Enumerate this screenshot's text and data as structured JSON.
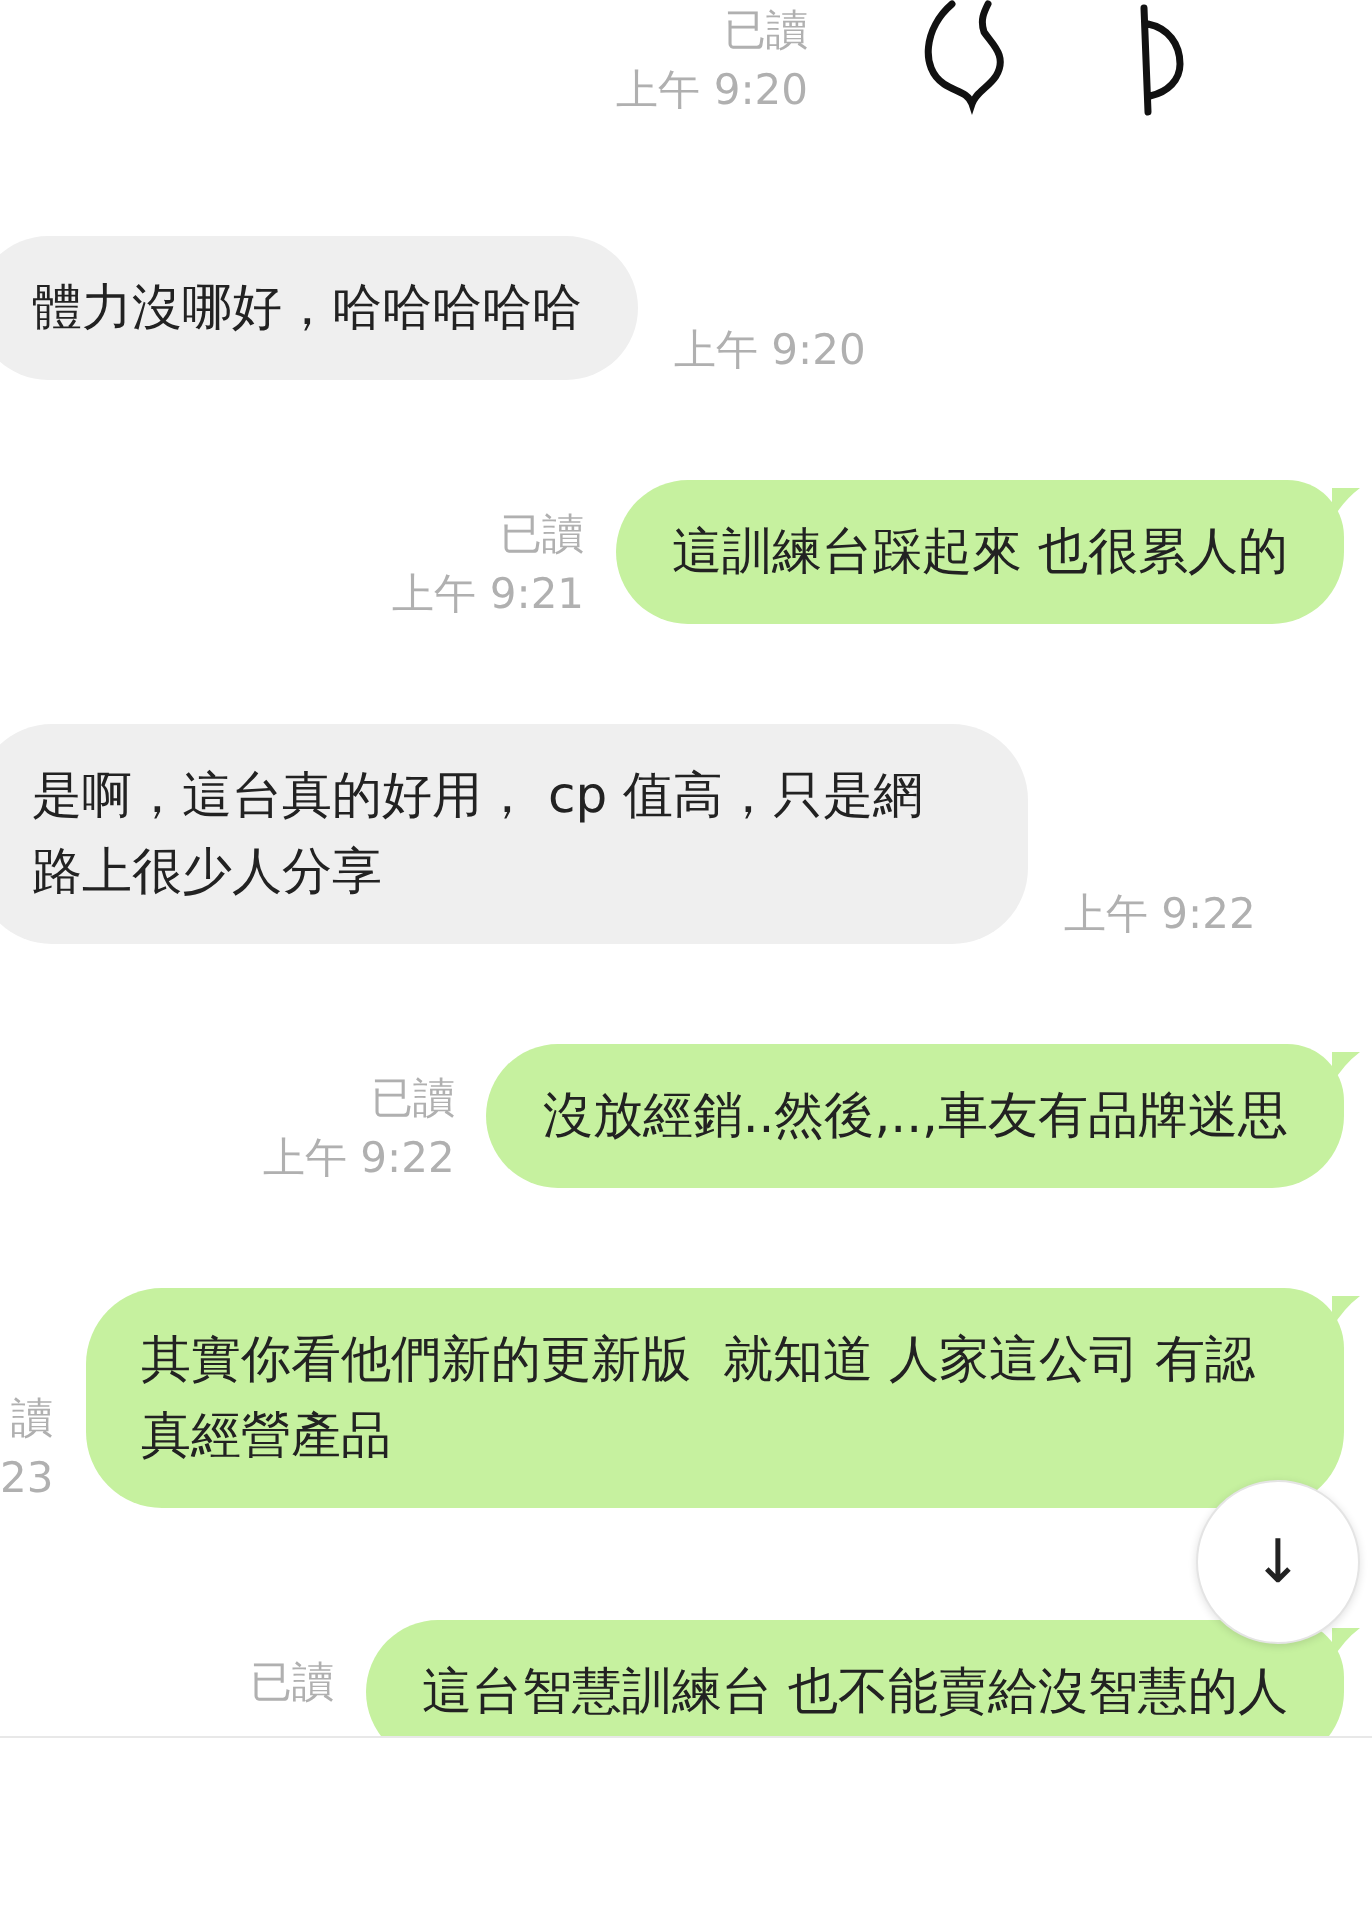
{
  "messages": [
    {
      "kind": "sticker",
      "read": "已讀",
      "time": "上午 9:20"
    },
    {
      "kind": "received",
      "text": "體力沒哪好，哈哈哈哈哈",
      "time": "上午 9:20"
    },
    {
      "kind": "sent",
      "read": "已讀",
      "time": "上午 9:21",
      "text": "這訓練台踩起來 也很累人的"
    },
    {
      "kind": "received",
      "text": "是啊，這台真的好用， cp 值高，只是網路上很少人分享",
      "time": "上午 9:22"
    },
    {
      "kind": "sent",
      "read": "已讀",
      "time": "上午 9:22",
      "text": "沒放經銷..然後,..,車友有品牌迷思"
    },
    {
      "kind": "sent",
      "read": "讀",
      "time": "23",
      "text": "其實你看他們新的更新版  就知道 人家這公司 有認真經營產品"
    },
    {
      "kind": "sent",
      "read": "已讀",
      "text": "這台智慧訓練台 也不能賣給沒智慧的人"
    }
  ],
  "scroll_button": {
    "icon": "↓"
  }
}
